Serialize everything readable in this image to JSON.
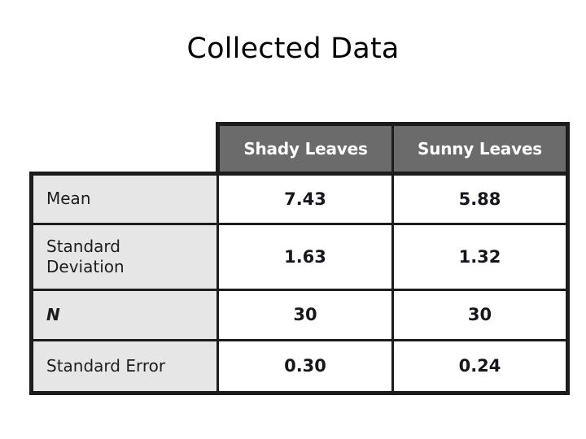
{
  "slide": {
    "title": "Collected Data",
    "background_color": "#ffffff"
  },
  "colors": {
    "header_fill": "#6b6b6b",
    "header_text": "#ffffff",
    "row_label_fill": "#e6e6e6",
    "data_cell_fill": "#ffffff",
    "border": "#1c1c1c",
    "body_text": "#15171c"
  },
  "table": {
    "corner_label": "",
    "column_headers": [
      "Shady Leaves",
      "Sunny Leaves"
    ],
    "rows": [
      {
        "label": "Mean",
        "label_line1": "Mean",
        "label_line2": "",
        "italic": false,
        "values": [
          "7.43",
          "5.88"
        ]
      },
      {
        "label": "Standard Deviation",
        "label_line1": "Standard",
        "label_line2": "Deviation",
        "italic": false,
        "values": [
          "1.63",
          "1.32"
        ]
      },
      {
        "label": "N",
        "label_line1": "N",
        "label_line2": "",
        "italic": true,
        "values": [
          "30",
          "30"
        ]
      },
      {
        "label": "Standard Error",
        "label_line1": "Standard Error",
        "label_line2": "",
        "italic": false,
        "values": [
          "0.30",
          "0.24"
        ]
      }
    ]
  },
  "chart_data": {
    "type": "table",
    "title": "Collected Data",
    "categories": [
      "Shady Leaves",
      "Sunny Leaves"
    ],
    "row_names": [
      "Mean",
      "Standard Deviation",
      "N",
      "Standard Error"
    ],
    "series": [
      {
        "name": "Shady Leaves",
        "values": [
          7.43,
          1.63,
          30,
          0.3
        ]
      },
      {
        "name": "Sunny Leaves",
        "values": [
          5.88,
          1.32,
          30,
          0.24
        ]
      }
    ],
    "xlabel": "",
    "ylabel": "",
    "grid": true,
    "legend": "none"
  }
}
